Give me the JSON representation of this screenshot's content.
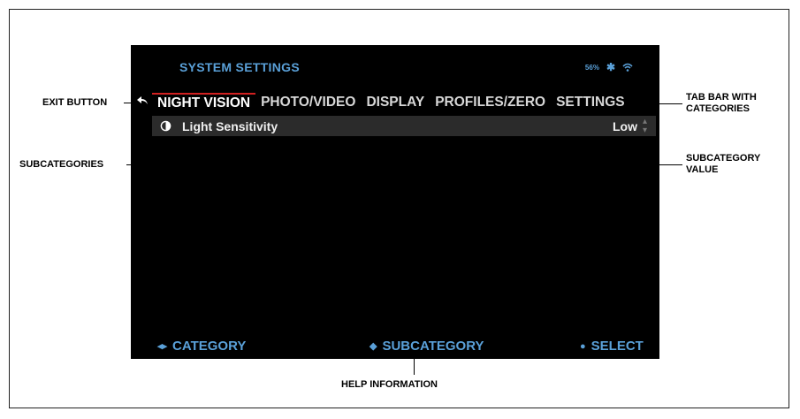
{
  "screen": {
    "title": "SYSTEM SETTINGS",
    "battery": "56%",
    "tabs": [
      "NIGHT VISION",
      "PHOTO/VIDEO",
      "DISPLAY",
      "PROFILES/ZERO",
      "SETTINGS"
    ],
    "active_tab_index": 0,
    "subcategory": {
      "label": "Light Sensitivity",
      "value": "Low"
    },
    "help": {
      "category": "CATEGORY",
      "subcategory": "SUBCATEGORY",
      "select": "SELECT"
    }
  },
  "callouts": {
    "exit": "EXIT BUTTON",
    "tabbar": "TAB BAR WITH CATEGORIES",
    "subcategories": "SUBCATEGORIES",
    "subvalue": "SUBCATEGORY VALUE",
    "helpinfo": "HELP INFORMATION"
  },
  "colors": {
    "accent": "#5aa0d8",
    "tab_indicator": "#d12020"
  }
}
